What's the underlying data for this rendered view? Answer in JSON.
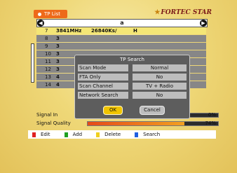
{
  "header": {
    "title": "TP List",
    "brand": "FORTEC STAR"
  },
  "satellite": {
    "name": "a",
    "left_arrow": "◀",
    "right_arrow": "▶"
  },
  "list": {
    "rows": [
      {
        "num": "7",
        "freq": "3841MHz",
        "sym": "26840Ks/",
        "pol": "H"
      },
      {
        "num": "8",
        "freq": "3",
        "sym": "",
        "pol": ""
      },
      {
        "num": "9",
        "freq": "3",
        "sym": "",
        "pol": ""
      },
      {
        "num": "10",
        "freq": "3",
        "sym": "",
        "pol": ""
      },
      {
        "num": "11",
        "freq": "3",
        "sym": "",
        "pol": ""
      },
      {
        "num": "12",
        "freq": "3",
        "sym": "",
        "pol": ""
      },
      {
        "num": "13",
        "freq": "4",
        "sym": "",
        "pol": ""
      },
      {
        "num": "14",
        "freq": "4",
        "sym": "",
        "pol": ""
      }
    ]
  },
  "signal": {
    "intensity_label": "Signal In",
    "intensity_value": "0%",
    "intensity_pct": 0,
    "quality_label": "Signal Quality",
    "quality_value": "74%",
    "quality_pct": 74
  },
  "bottom": {
    "items": [
      {
        "label": "Edit",
        "color": "#e02020"
      },
      {
        "label": "Add",
        "color": "#20a020"
      },
      {
        "label": "Delete",
        "color": "#f0d020"
      },
      {
        "label": "Search",
        "color": "#2060e0"
      }
    ]
  },
  "dialog": {
    "title": "TP Search",
    "rows": [
      {
        "label": "Scan Mode",
        "value": "Normal"
      },
      {
        "label": "FTA Only",
        "value": "No"
      },
      {
        "label": "Scan Channel",
        "value": "TV + Radio"
      },
      {
        "label": "Network Search",
        "value": "No"
      }
    ],
    "ok": "OK",
    "cancel": "Cancel"
  }
}
